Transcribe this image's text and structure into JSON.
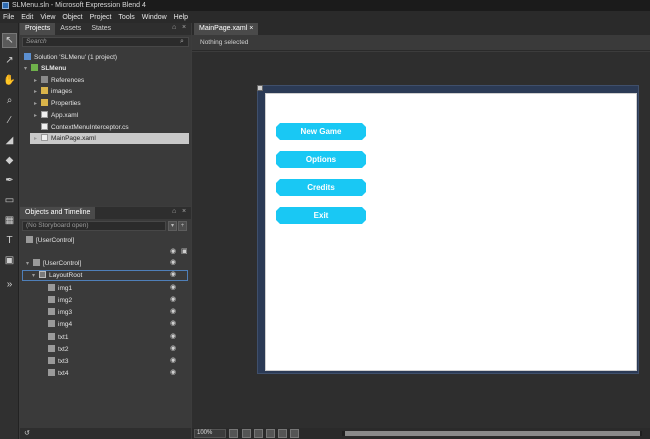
{
  "window": {
    "title": "SLMenu.sln - Microsoft Expression Blend 4"
  },
  "menubar": {
    "items": [
      "File",
      "Edit",
      "View",
      "Object",
      "Project",
      "Tools",
      "Window",
      "Help"
    ]
  },
  "projects_panel": {
    "tabs": [
      "Projects",
      "Assets",
      "States"
    ],
    "search_placeholder": "Search",
    "tree": [
      {
        "label": "Solution 'SLMenu' (1 project)",
        "icon": "solution-icon"
      },
      {
        "label": "SLMenu",
        "icon": "project-icon"
      },
      {
        "label": "References",
        "icon": "references-icon"
      },
      {
        "label": "images",
        "icon": "folder-icon"
      },
      {
        "label": "Properties",
        "icon": "folder-icon"
      },
      {
        "label": "App.xaml",
        "icon": "file-icon"
      },
      {
        "label": "ContextMenuInterceptor.cs",
        "icon": "file-icon"
      },
      {
        "label": "MainPage.xaml",
        "icon": "file-icon",
        "selected": true
      }
    ]
  },
  "objects_panel": {
    "title": "Objects and Timeline",
    "storyboard": "(No Storyboard open)",
    "root_label": "[UserControl]",
    "tree": [
      {
        "label": "[UserControl]"
      },
      {
        "label": "LayoutRoot"
      },
      {
        "label": "img1"
      },
      {
        "label": "img2"
      },
      {
        "label": "img3"
      },
      {
        "label": "img4"
      },
      {
        "label": "txt1"
      },
      {
        "label": "txt2"
      },
      {
        "label": "txt3"
      },
      {
        "label": "txt4"
      }
    ]
  },
  "document": {
    "tab_label": "MainPage.xaml",
    "breadcrumb": "Nothing selected",
    "buttons": [
      "New Game",
      "Options",
      "Credits",
      "Exit"
    ],
    "button_color": "#19c8f4"
  },
  "statusbar": {
    "zoom": "100%"
  }
}
